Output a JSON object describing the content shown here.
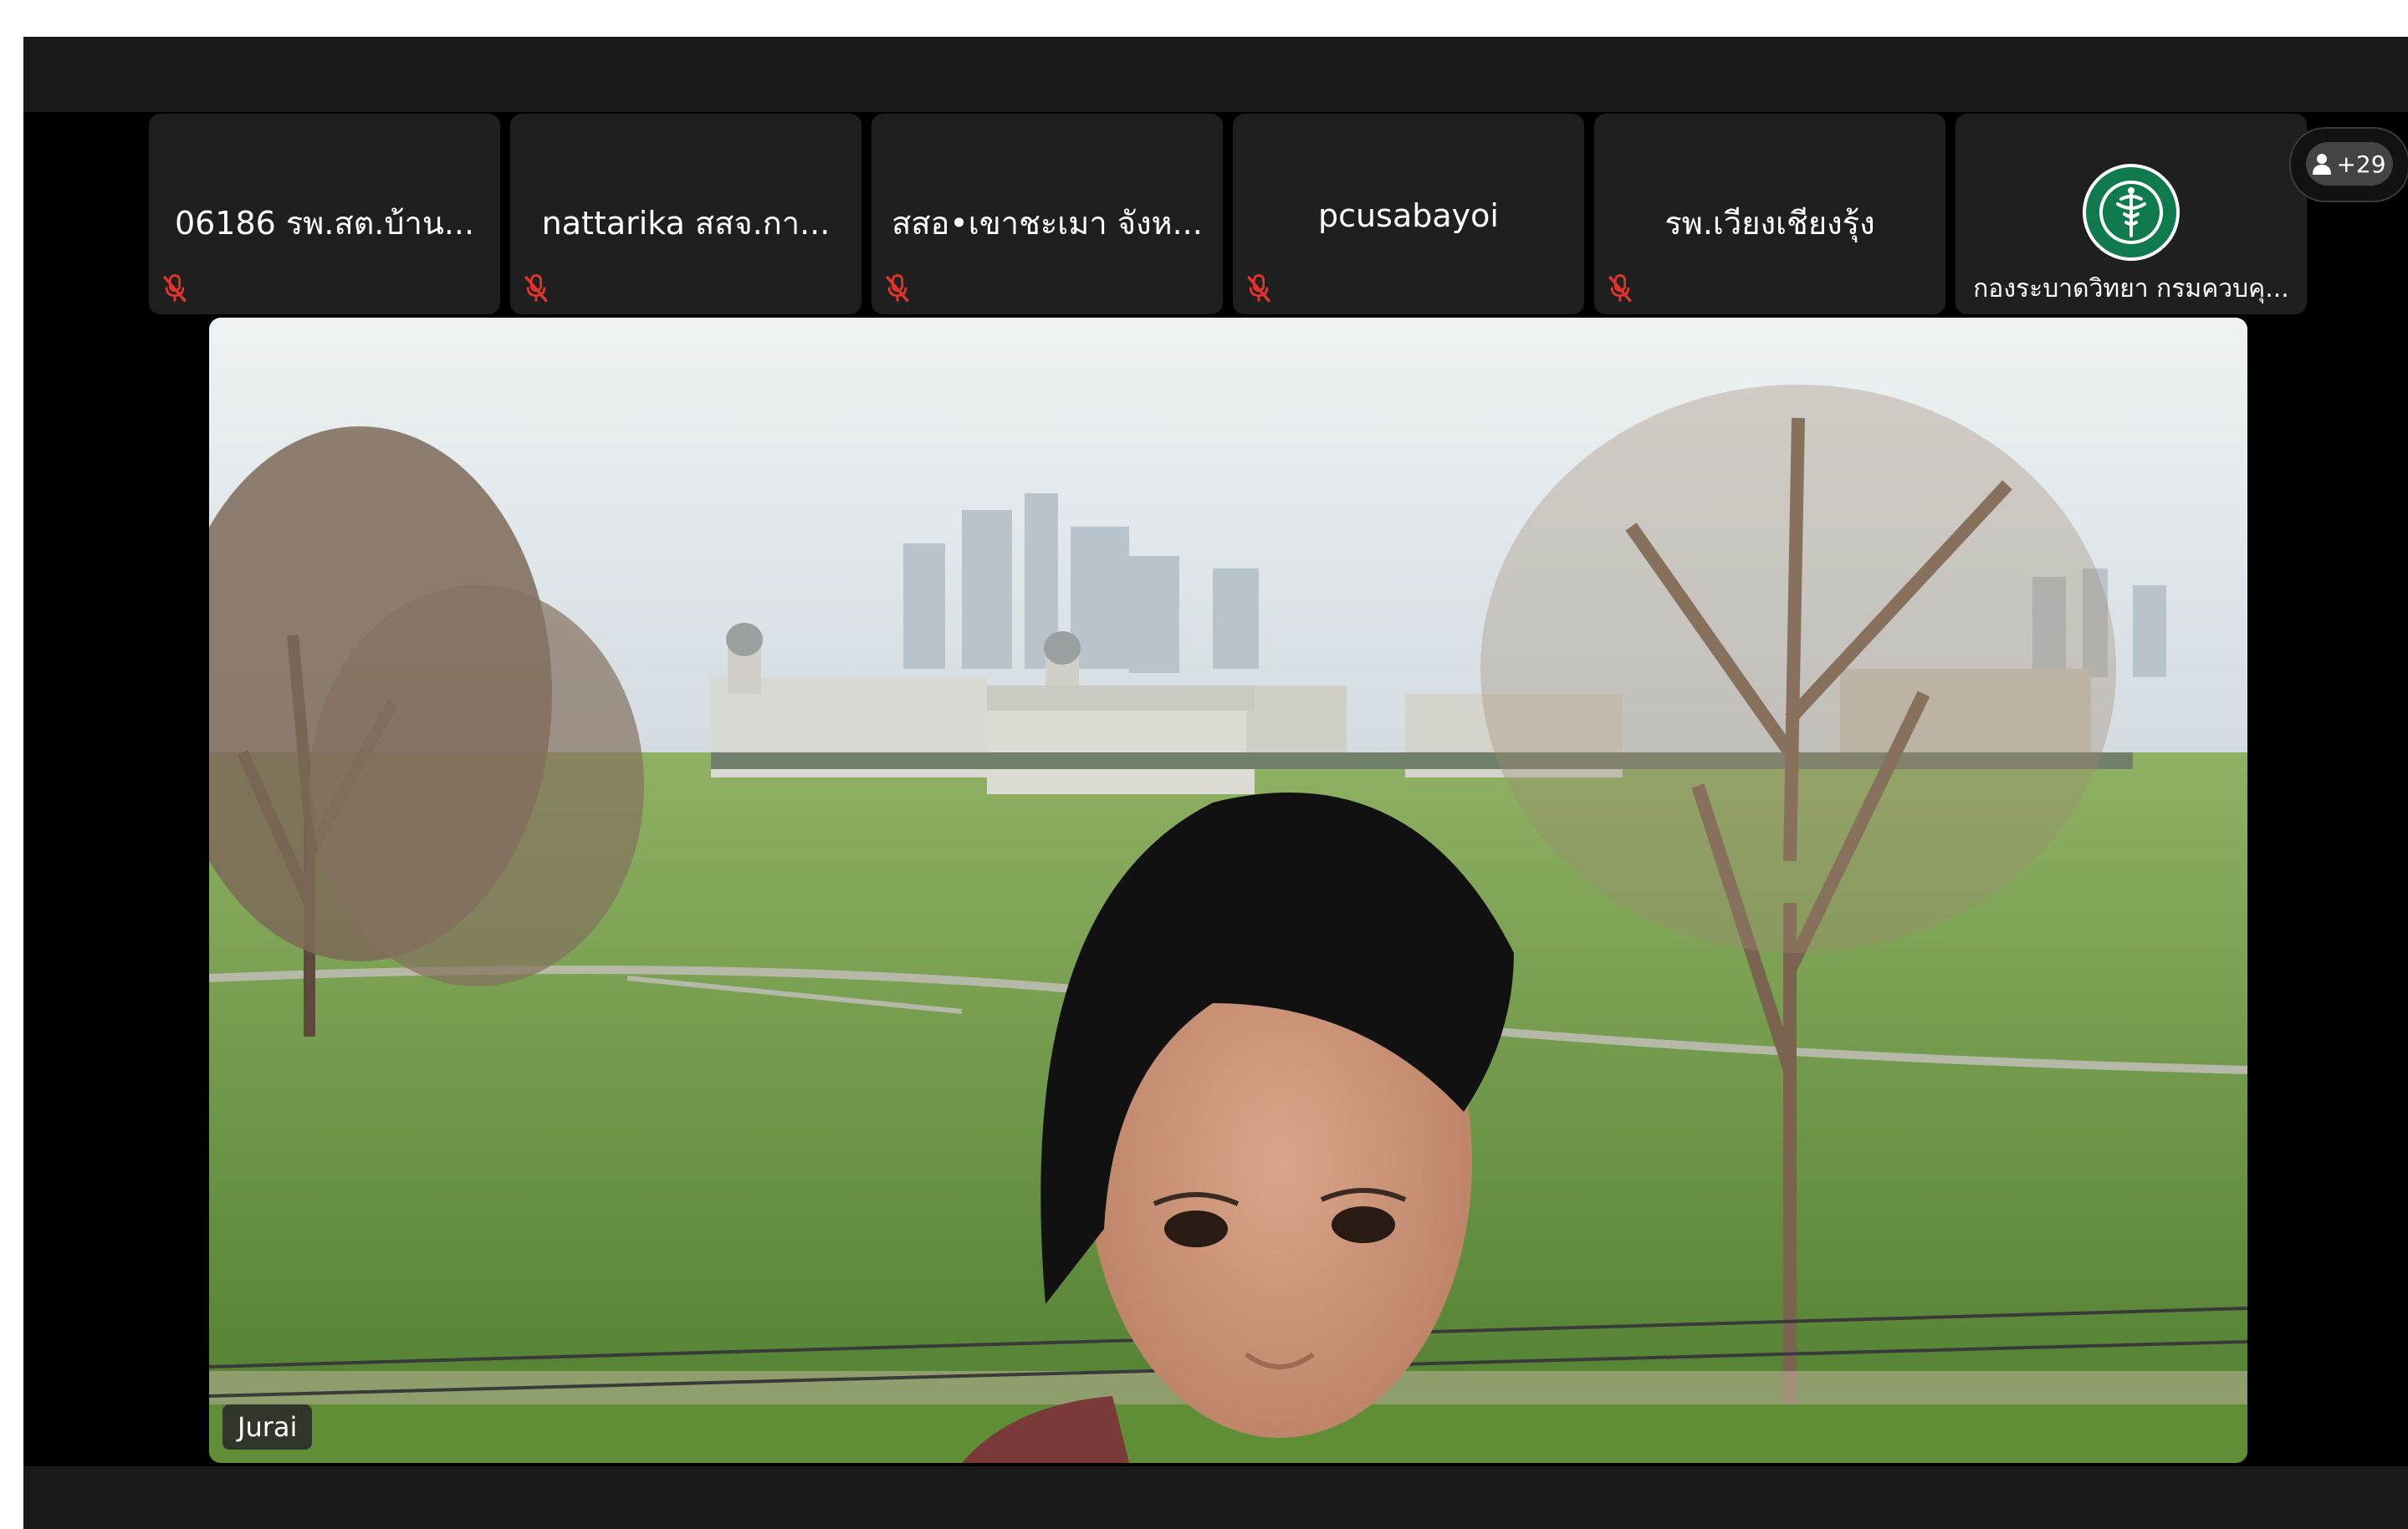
{
  "participants": [
    {
      "name": "06186 รพ.สต.บ้าน...",
      "muted": true
    },
    {
      "name": "nattarika สสจ.กา...",
      "muted": true
    },
    {
      "name": "สสอ•เขาชะเมา จังห...",
      "muted": true
    },
    {
      "name": "pcusabayoi",
      "muted": true
    },
    {
      "name": "รพ.เวียงเชียงรุ้ง",
      "muted": true
    },
    {
      "name": "กองระบาดวิทยา กรมควบคุ...",
      "muted": false,
      "avatar": "ddc-logo"
    }
  ],
  "overflow_count": "+29",
  "main_video": {
    "speaker_name": "Jurai"
  },
  "colors": {
    "mute_icon": "#e0342c",
    "tile_bg": "#1f1f1f",
    "bar_bg": "#1a1a1a",
    "logo_green": "#0e7a4e"
  },
  "icons": {
    "mute": "mic-off-icon",
    "more": "person-icon"
  }
}
